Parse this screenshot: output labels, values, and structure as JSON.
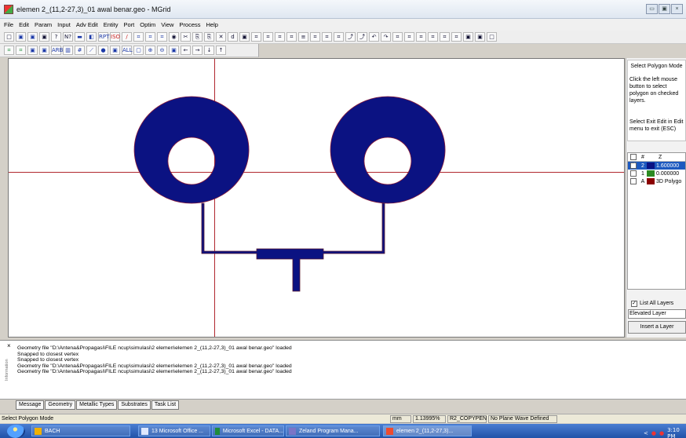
{
  "window": {
    "title": "elemen 2_(11,2-27,3)_01 awal benar.geo - MGrid",
    "controls": [
      "▭",
      "▣",
      "×"
    ]
  },
  "menu": [
    "File",
    "Edit",
    "Param",
    "Input",
    "Adv Edit",
    "Entity",
    "Port",
    "Optim",
    "View",
    "Process",
    "Help"
  ],
  "toolbar1": [
    "□",
    "▣",
    "▣",
    "▣",
    "?",
    "N?",
    "▬",
    "◧",
    "RPT",
    "ISO",
    "/",
    "⌗",
    "⌗",
    "⌗",
    "◉",
    "✂",
    "⎘",
    "⎘",
    "✕",
    "d",
    "▣",
    "⌗",
    "⌗",
    "⌗",
    "⌗",
    "≡",
    "⌗",
    "⌗",
    "⌗",
    "⤴",
    "⤴",
    "↶",
    "↷",
    "⌗",
    "⌗",
    "⌗",
    "⌗",
    "⌗",
    "⌗",
    "▣",
    "▣",
    "□"
  ],
  "toolbar2": [
    "⌗",
    "⌗",
    "▣",
    "▣",
    "ARB",
    "▥",
    "#",
    "⟋",
    "●",
    "▣",
    "ALL",
    "▢",
    "⊕",
    "⊖",
    "▣",
    "←",
    "→",
    "↓",
    "↑"
  ],
  "right_panel": {
    "mode_title": "Select Polygon Mode",
    "instruction": "Click the left mouse button to select polygon on checked layers.",
    "exit_hint": "Select Exit Edit in Edit menu to exit (ESC)",
    "columns": [
      "#",
      "Z"
    ],
    "layers": [
      {
        "checked": "✓",
        "number": "2",
        "value": "1.600000",
        "color": "#0b1282",
        "selected": true
      },
      {
        "checked": "",
        "number": "1",
        "value": "0.000000",
        "color": "#2c8a22",
        "selected": false
      },
      {
        "checked": "",
        "number": "A",
        "value": "3D Polygo",
        "color": "#8b0000",
        "selected": false
      }
    ],
    "list_all_label": "List All Layers",
    "list_all_checked": "✓",
    "elevated_layer": "Elevated Layer",
    "insert_button": "Insert a Layer"
  },
  "messages": [
    "Geometry file \"D:\\Antena&Propagasi\\FILE ncup\\simulasi\\2 elemen\\elemen 2_(11,2-27,3)_01 awal benar.geo\" loaded",
    "Snapped to closest vertex",
    "Snapped to closest vertex",
    "Geometry file \"D:\\Antena&Propagasi\\FILE ncup\\simulasi\\2 elemen\\elemen 2_(11,2-27,3)_01 awal benar.geo\" loaded",
    "Geometry file \"D:\\Antena&Propagasi\\FILE ncup\\simulasi\\2 elemen\\elemen 2_(11,2-27,3)_01 awal benar.geo\" loaded"
  ],
  "message_side_label": "Information",
  "bottom_tabs": [
    "Message",
    "Geometry",
    "Metallic Types",
    "Substrates",
    "Task List"
  ],
  "status": {
    "left": "Select Polygon Mode",
    "unit": "mm",
    "zoom": "1.13995%",
    "mode": "R2_COPYPEN",
    "wave": "No Plane Wave Defined"
  },
  "taskbar": {
    "tasks": [
      "BACH",
      "13 Microsoft Office ...",
      "Microsoft Excel - DATA...",
      "Zeland Program Mana...",
      "elemen 2_(11,2-27,3)..."
    ],
    "tray_icons": [
      "<",
      "●",
      "●"
    ],
    "time": "3:10 PM"
  }
}
